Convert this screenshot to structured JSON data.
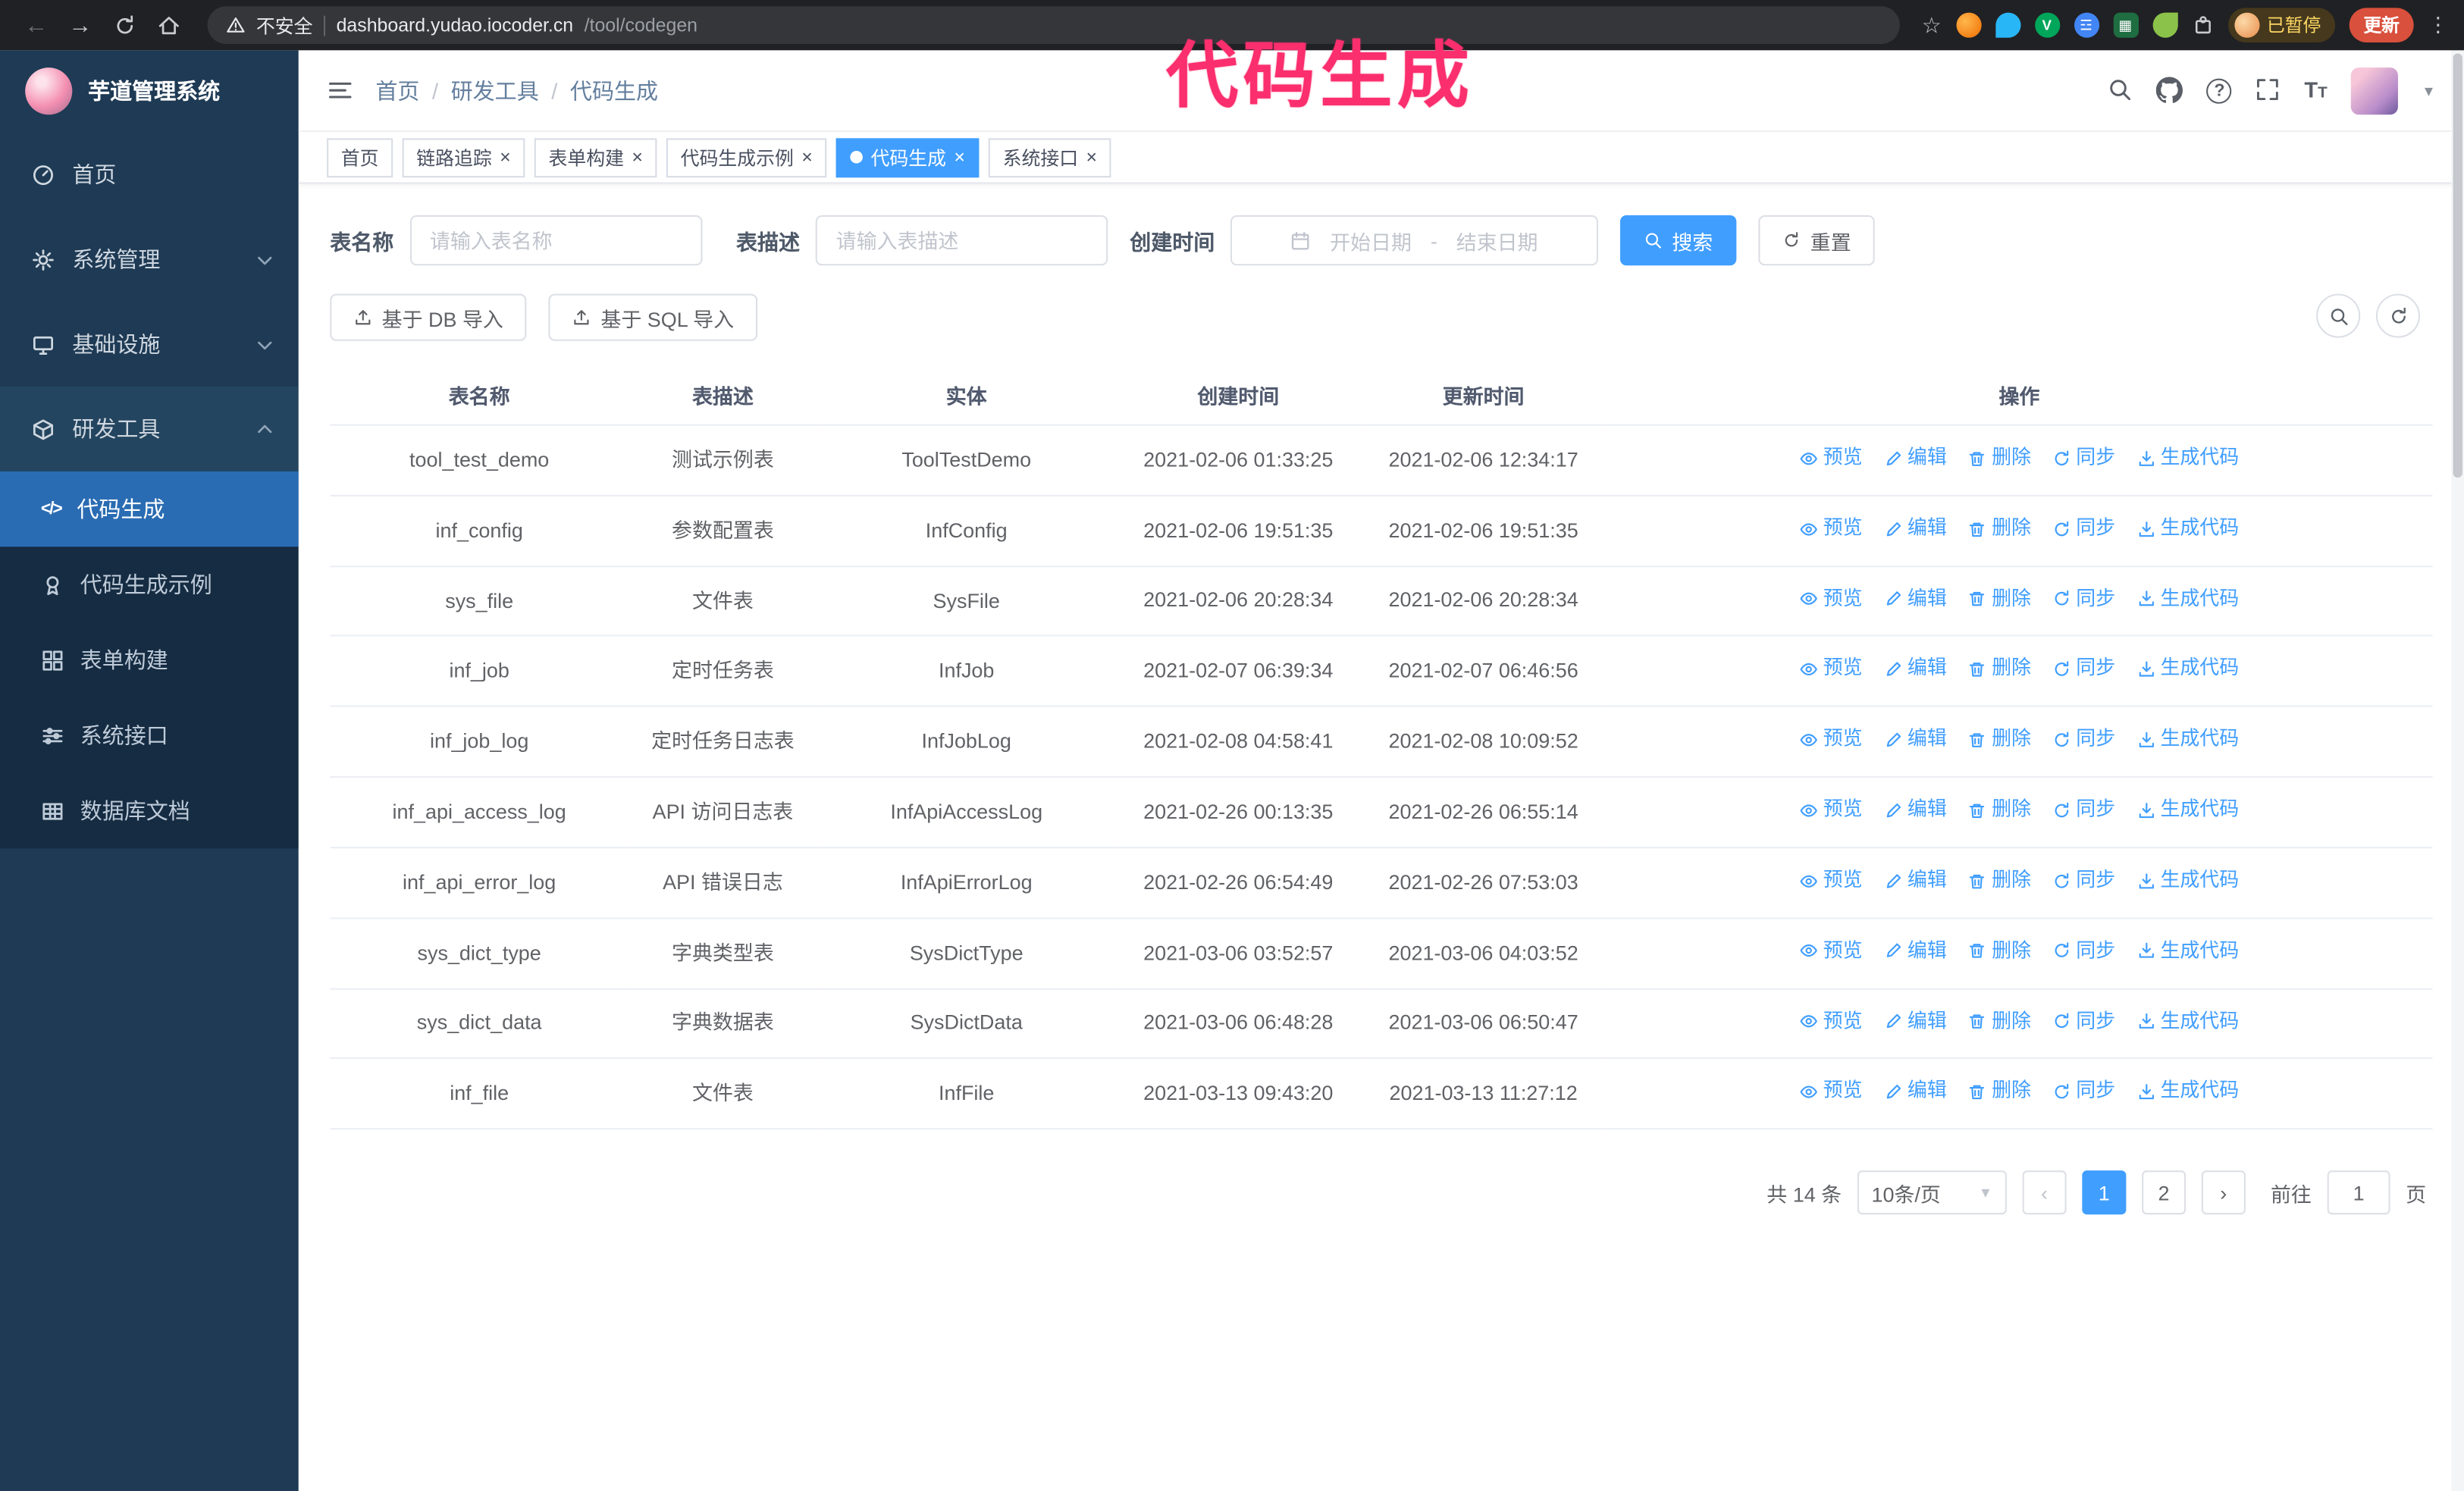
{
  "colors": {
    "primary": "#409eff",
    "sidebar_bg": "#1e3a54",
    "sidebar_submenu_bg": "#152c42",
    "sidebar_active_bg": "#2a6cb3",
    "annotation": "#fb2e6e",
    "update_button_bg": "#d9503c",
    "paused_text": "#fdd663",
    "chrome_bg": "#202124"
  },
  "annotation": {
    "text": "代码生成",
    "color": "#fb2e6e"
  },
  "browser": {
    "url_warning": "不安全",
    "url_host": "dashboard.yudao.iocoder.cn",
    "url_path": "/tool/codegen",
    "paused_badge": "已暂停",
    "update_button": "更新"
  },
  "icons": {
    "chrome": [
      "back-icon",
      "forward-icon",
      "reload-icon",
      "home-icon",
      "warning-icon",
      "star-icon",
      "extensions",
      "puzzle-icon",
      "kebab-icon"
    ],
    "topbar": [
      "hamburger-icon",
      "search-icon",
      "github-icon",
      "help-icon",
      "fullscreen-icon",
      "fontsize-icon"
    ],
    "row_ops": [
      "eye-icon",
      "pencil-icon",
      "trash-icon",
      "sync-icon",
      "download-icon"
    ]
  },
  "sidebar": {
    "logo_title": "芋道管理系统",
    "items": [
      {
        "label": "首页",
        "icon": "dashboard-icon"
      },
      {
        "label": "系统管理",
        "icon": "gear-icon"
      },
      {
        "label": "基础设施",
        "icon": "monitor-icon"
      },
      {
        "label": "研发工具",
        "icon": "cube-icon",
        "expanded": true
      }
    ],
    "sub_items": [
      {
        "label": "代码生成",
        "icon": "code-icon",
        "active": true
      },
      {
        "label": "代码生成示例",
        "icon": "medal-icon"
      },
      {
        "label": "表单构建",
        "icon": "form-icon"
      },
      {
        "label": "系统接口",
        "icon": "sliders-icon"
      },
      {
        "label": "数据库文档",
        "icon": "table-grid-icon"
      }
    ]
  },
  "header": {
    "breadcrumb": [
      "首页",
      "研发工具",
      "代码生成"
    ]
  },
  "tabs": [
    {
      "label": "首页",
      "closable": false,
      "active": false
    },
    {
      "label": "链路追踪",
      "closable": true,
      "active": false
    },
    {
      "label": "表单构建",
      "closable": true,
      "active": false
    },
    {
      "label": "代码生成示例",
      "closable": true,
      "active": false
    },
    {
      "label": "代码生成",
      "closable": true,
      "active": true
    },
    {
      "label": "系统接口",
      "closable": true,
      "active": false
    }
  ],
  "filters": {
    "table_name_label": "表名称",
    "table_name_placeholder": "请输入表名称",
    "table_desc_label": "表描述",
    "table_desc_placeholder": "请输入表描述",
    "create_time_label": "创建时间",
    "date_start_placeholder": "开始日期",
    "date_separator": "-",
    "date_end_placeholder": "结束日期",
    "search_label": "搜索",
    "reset_label": "重置"
  },
  "toolbar": {
    "import_db_label": "基于 DB 导入",
    "import_sql_label": "基于 SQL 导入"
  },
  "table": {
    "columns": [
      "表名称",
      "表描述",
      "实体",
      "创建时间",
      "更新时间",
      "操作"
    ],
    "ops": [
      "预览",
      "编辑",
      "删除",
      "同步",
      "生成代码"
    ],
    "rows": [
      {
        "name": "tool_test_demo",
        "desc": "测试示例表",
        "entity": "ToolTestDemo",
        "created": "2021-02-06 01:33:25",
        "updated": "2021-02-06 12:34:17"
      },
      {
        "name": "inf_config",
        "desc": "参数配置表",
        "entity": "InfConfig",
        "created": "2021-02-06 19:51:35",
        "updated": "2021-02-06 19:51:35"
      },
      {
        "name": "sys_file",
        "desc": "文件表",
        "entity": "SysFile",
        "created": "2021-02-06 20:28:34",
        "updated": "2021-02-06 20:28:34"
      },
      {
        "name": "inf_job",
        "desc": "定时任务表",
        "entity": "InfJob",
        "created": "2021-02-07 06:39:34",
        "updated": "2021-02-07 06:46:56"
      },
      {
        "name": "inf_job_log",
        "desc": "定时任务日志表",
        "entity": "InfJobLog",
        "created": "2021-02-08 04:58:41",
        "updated": "2021-02-08 10:09:52"
      },
      {
        "name": "inf_api_access_log",
        "desc": "API 访问日志表",
        "entity": "InfApiAccessLog",
        "created": "2021-02-26 00:13:35",
        "updated": "2021-02-26 06:55:14"
      },
      {
        "name": "inf_api_error_log",
        "desc": "API 错误日志",
        "entity": "InfApiErrorLog",
        "created": "2021-02-26 06:54:49",
        "updated": "2021-02-26 07:53:03"
      },
      {
        "name": "sys_dict_type",
        "desc": "字典类型表",
        "entity": "SysDictType",
        "created": "2021-03-06 03:52:57",
        "updated": "2021-03-06 04:03:52"
      },
      {
        "name": "sys_dict_data",
        "desc": "字典数据表",
        "entity": "SysDictData",
        "created": "2021-03-06 06:48:28",
        "updated": "2021-03-06 06:50:47"
      },
      {
        "name": "inf_file",
        "desc": "文件表",
        "entity": "InfFile",
        "created": "2021-03-13 09:43:20",
        "updated": "2021-03-13 11:27:12"
      }
    ]
  },
  "pagination": {
    "total": "共 14 条",
    "page_size": "10条/页",
    "pages": [
      {
        "label": "1",
        "active": true
      },
      {
        "label": "2",
        "active": false
      }
    ],
    "goto_label": "前往",
    "goto_value": "1",
    "goto_suffix": "页"
  }
}
